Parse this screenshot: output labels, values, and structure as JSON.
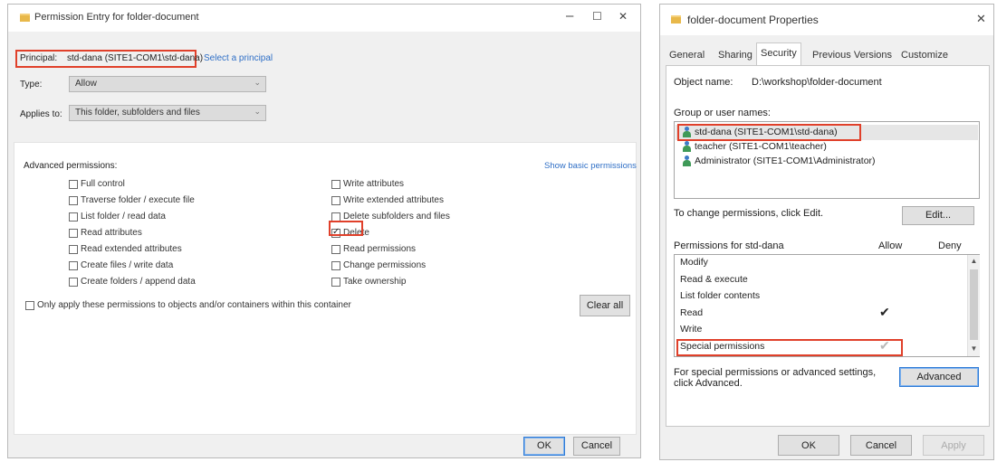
{
  "left": {
    "title": "Permission Entry for folder-document",
    "controls": {
      "minimize": "–",
      "maximize": "☐",
      "close": "✕"
    },
    "principal": {
      "label": "Principal:",
      "value": "std-dana (SITE1-COM1\\std-dana)",
      "link": "Select a principal"
    },
    "type": {
      "label": "Type:",
      "value": "Allow"
    },
    "applies": {
      "label": "Applies to:",
      "value": "This folder, subfolders and files"
    },
    "advanced_label": "Advanced permissions:",
    "show_basic": "Show basic permissions",
    "left_perms": [
      {
        "label": "Full control",
        "checked": false
      },
      {
        "label": "Traverse folder / execute file",
        "checked": false
      },
      {
        "label": "List folder / read data",
        "checked": false
      },
      {
        "label": "Read attributes",
        "checked": false
      },
      {
        "label": "Read extended attributes",
        "checked": false
      },
      {
        "label": "Create files / write data",
        "checked": false
      },
      {
        "label": "Create folders / append data",
        "checked": false
      }
    ],
    "right_perms": [
      {
        "label": "Write attributes",
        "checked": false
      },
      {
        "label": "Write extended attributes",
        "checked": false
      },
      {
        "label": "Delete subfolders and files",
        "checked": false
      },
      {
        "label": "Delete",
        "checked": true
      },
      {
        "label": "Read permissions",
        "checked": false
      },
      {
        "label": "Change permissions",
        "checked": false
      },
      {
        "label": "Take ownership",
        "checked": false
      }
    ],
    "only_apply": "Only apply these permissions to objects and/or containers within this container",
    "clear_all": "Clear all",
    "ok": "OK",
    "cancel": "Cancel"
  },
  "right": {
    "title": "folder-document Properties",
    "close": "✕",
    "tabs": [
      "General",
      "Sharing",
      "Security",
      "Previous Versions",
      "Customize"
    ],
    "active_tab": "Security",
    "object_label": "Object name:",
    "object_value": "D:\\workshop\\folder-document",
    "group_label": "Group or user names:",
    "users": [
      "std-dana (SITE1-COM1\\std-dana)",
      "teacher (SITE1-COM1\\teacher)",
      "Administrator (SITE1-COM1\\Administrator)"
    ],
    "change_text": "To change permissions, click Edit.",
    "edit": "Edit...",
    "perm_for": "Permissions for std-dana",
    "allow": "Allow",
    "deny": "Deny",
    "perms": [
      {
        "label": "Modify",
        "allow": false
      },
      {
        "label": "Read & execute",
        "allow": false
      },
      {
        "label": "List folder contents",
        "allow": false
      },
      {
        "label": "Read",
        "allow": true
      },
      {
        "label": "Write",
        "allow": false
      },
      {
        "label": "Special permissions",
        "allow": true
      }
    ],
    "advanced_text_1": "For special permissions or advanced settings,",
    "advanced_text_2": "click Advanced.",
    "advanced": "Advanced",
    "ok": "OK",
    "cancel": "Cancel",
    "apply": "Apply",
    "check_glyph": "✔",
    "scroll_up": "▲",
    "scroll_down": "▼",
    "combo_arrow": "⌄"
  }
}
